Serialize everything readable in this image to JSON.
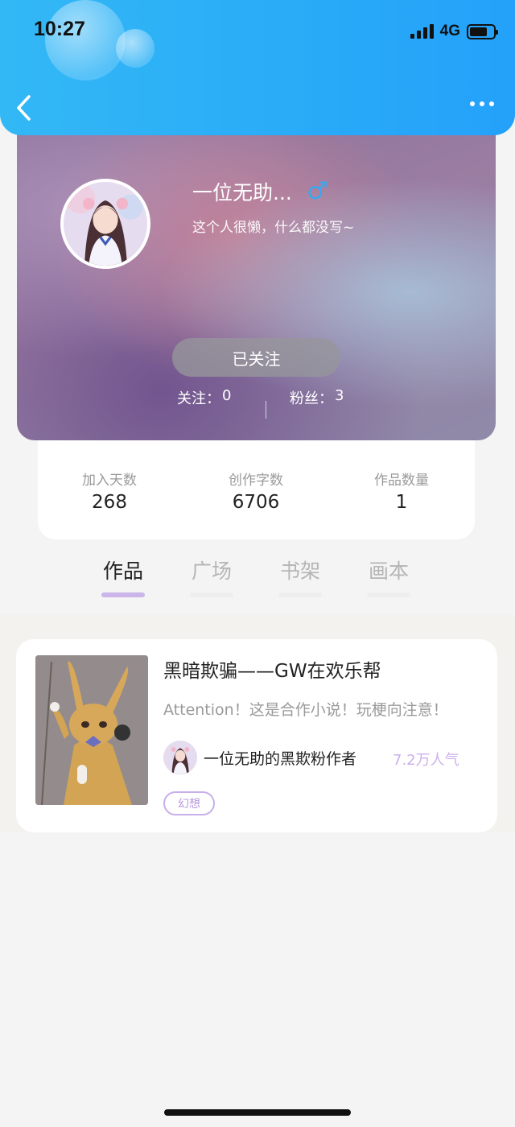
{
  "status_bar": {
    "time": "10:27",
    "network": "4G",
    "signal_bars": 4,
    "battery_level": 0.75
  },
  "header": {
    "back_icon": "chevron-left-icon",
    "more_icon": "more-dots-icon"
  },
  "profile": {
    "nickname": "一位无助...",
    "gender_symbol": "♂",
    "bio": "这个人很懒，什么都没写~",
    "follow_button": "已关注",
    "following_label": "关注：",
    "following_count": "0",
    "fans_label": "粉丝：",
    "fans_count": "3"
  },
  "stats": {
    "days_label": "加入天数",
    "days_value": "268",
    "words_label": "创作字数",
    "words_value": "6706",
    "works_label": "作品数量",
    "works_value": "1"
  },
  "tabs": [
    {
      "label": "作品",
      "active": true
    },
    {
      "label": "广场",
      "active": false
    },
    {
      "label": "书架",
      "active": false
    },
    {
      "label": "画本",
      "active": false
    }
  ],
  "books": [
    {
      "title": "黑暗欺骗——GW在欢乐帮",
      "intro": "Attention！这是合作小说！玩梗向注意！",
      "author": "一位无助的黑欺粉作者",
      "popularity": "7.2万人气",
      "tag": "幻想"
    }
  ],
  "colors": {
    "header_blue": "#2aacf7",
    "accent_purple": "#cbb5ea",
    "gender_blue": "#3aa7ee"
  }
}
